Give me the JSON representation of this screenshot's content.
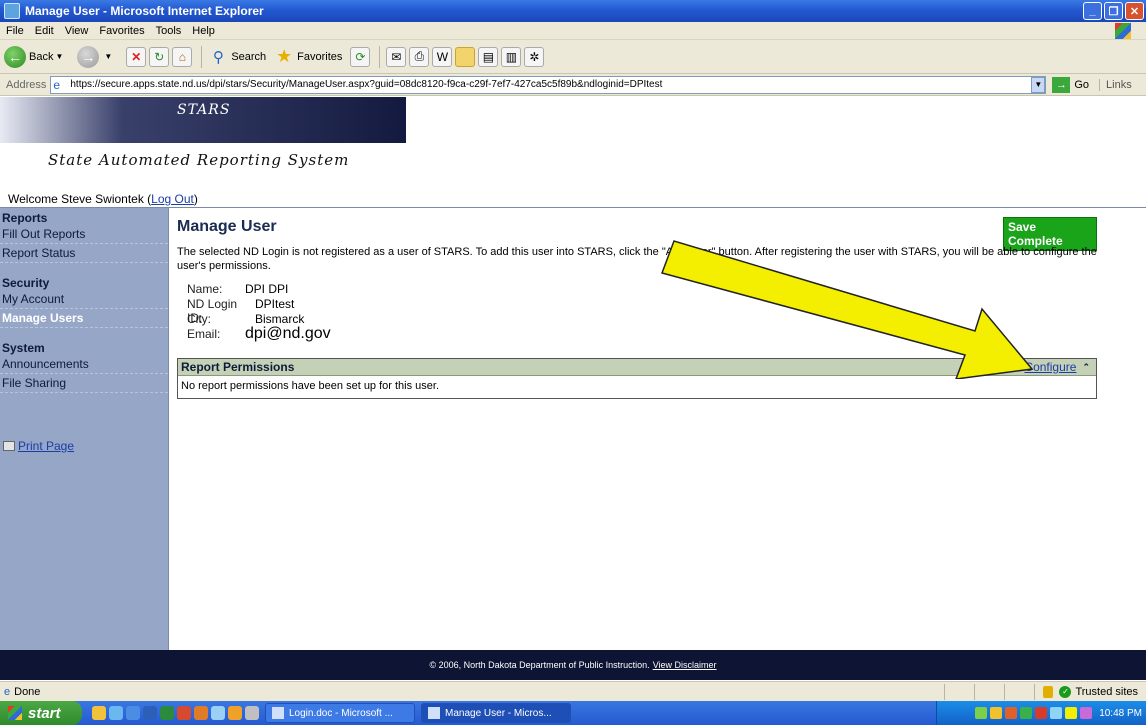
{
  "window": {
    "title": "Manage User - Microsoft Internet Explorer"
  },
  "menu": [
    "File",
    "Edit",
    "View",
    "Favorites",
    "Tools",
    "Help"
  ],
  "toolbar": {
    "back_label": "Back",
    "search_label": "Search",
    "favorites_label": "Favorites"
  },
  "address": {
    "label": "Address",
    "url": "https://secure.apps.state.nd.us/dpi/stars/Security/ManageUser.aspx?guid=08dc8120-f9ca-c29f-7ef7-427ca5c5f89b&ndloginid=DPItest",
    "go_label": "Go",
    "links_label": "Links"
  },
  "site": {
    "banner_title": "STARS",
    "subtitle": "State Automated Reporting System",
    "welcome_prefix": "Welcome Steve Swiontek (",
    "logout_label": "Log Out",
    "welcome_suffix": ")"
  },
  "sidebar": {
    "reports_heading": "Reports",
    "reports_items": [
      "Fill Out Reports",
      "Report Status"
    ],
    "security_heading": "Security",
    "security_items": [
      "My Account",
      "Manage Users"
    ],
    "system_heading": "System",
    "system_items": [
      "Announcements",
      "File Sharing"
    ],
    "print_label": "Print Page"
  },
  "main": {
    "title": "Manage User",
    "save_badge": "Save Complete",
    "intro": "The selected ND Login is not registered as a user of STARS. To add this user into STARS, click the \"Add User\" button. After registering the user with STARS, you will be able to configure the user's permissions.",
    "info": {
      "name_label": "Name:",
      "name_value": "DPI DPI",
      "login_label": "ND Login ID:",
      "login_value": "DPItest",
      "city_label": "City:",
      "city_value": "Bismarck",
      "email_label": "Email:",
      "email_value": "dpi@nd.gov"
    },
    "permissions": {
      "heading": "Report Permissions",
      "configure_label": "Configure",
      "empty_message": "No report permissions have been set up for this user."
    }
  },
  "footer": {
    "text": "© 2006, North Dakota Department of Public Instruction.",
    "disclaimer_label": "View Disclaimer"
  },
  "status": {
    "text": "Done",
    "zone": "Trusted sites"
  },
  "taskbar": {
    "start_label": "start",
    "tasks": [
      "Login.doc - Microsoft ...",
      "Manage User - Micros..."
    ],
    "clock": "10:48 PM"
  },
  "colors": {
    "sidebar_bg": "#96a6c6",
    "save_green": "#1aa41a",
    "arrow_yellow": "#f4ef00",
    "footer_bg": "#0d1434"
  }
}
